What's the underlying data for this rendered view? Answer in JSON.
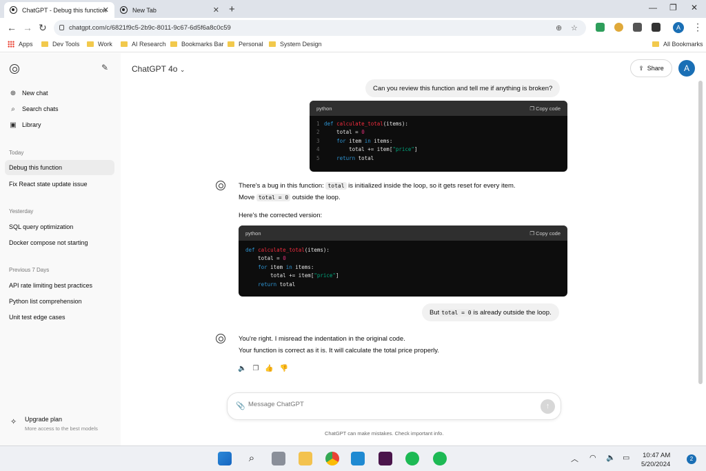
{
  "browser": {
    "tabs": [
      {
        "title": "ChatGPT - Debug this function",
        "active": true
      },
      {
        "title": "New Tab",
        "active": false
      }
    ],
    "url": "chatgpt.com/c/6821f9c5-2b9c-8011-9c67-6d5f6a8c0c59",
    "profile_initial": "A",
    "bookmarks": [
      "Apps",
      "Dev Tools",
      "Work",
      "AI Research",
      "Bookmarks Bar",
      "Personal",
      "System Design"
    ],
    "all_bookmarks": "All Bookmarks"
  },
  "sidebar": {
    "top_items": [
      "New chat",
      "Search chats",
      "Library"
    ],
    "sections": [
      {
        "label": "Today",
        "items": [
          "Debug this function",
          "Fix React state update issue"
        ]
      },
      {
        "label": "Yesterday",
        "items": [
          "SQL query optimization",
          "Docker compose not starting"
        ]
      },
      {
        "label": "Previous 7 Days",
        "items": [
          "API rate limiting best practices",
          "Python list comprehension",
          "Unit test edge cases"
        ]
      }
    ],
    "upgrade": {
      "title": "Upgrade plan",
      "subtitle": "More access to the best models"
    }
  },
  "header": {
    "model": "ChatGPT 4o",
    "share": "Share",
    "avatar": "A"
  },
  "conversation": {
    "user1": "Can you review this function and tell me if anything is broken?",
    "code_lang": "python",
    "copy_label": "Copy code",
    "bot1_line1_a": "There's a bug in this function: ",
    "bot1_line1_code": "total",
    "bot1_line1_b": " is initialized inside the loop, so it gets reset for every item.",
    "bot1_line2_a": "Move ",
    "bot1_line2_code": "total = 0",
    "bot1_line2_b": " outside the loop.",
    "bot1_line3": "Here's the corrected version:",
    "user2_a": "But ",
    "user2_code": "total = 0",
    "user2_b": " is already outside the loop.",
    "bot2_line1": "You're right. I misread the indentation in the original code.",
    "bot2_line2": "Your function is correct as it is. It will calculate the total price properly."
  },
  "composer": {
    "placeholder": "Message ChatGPT"
  },
  "disclaimer": "ChatGPT can make mistakes. Check important info.",
  "taskbar": {
    "time": "10:47 AM",
    "date": "5/20/2024",
    "notifications": "2"
  }
}
